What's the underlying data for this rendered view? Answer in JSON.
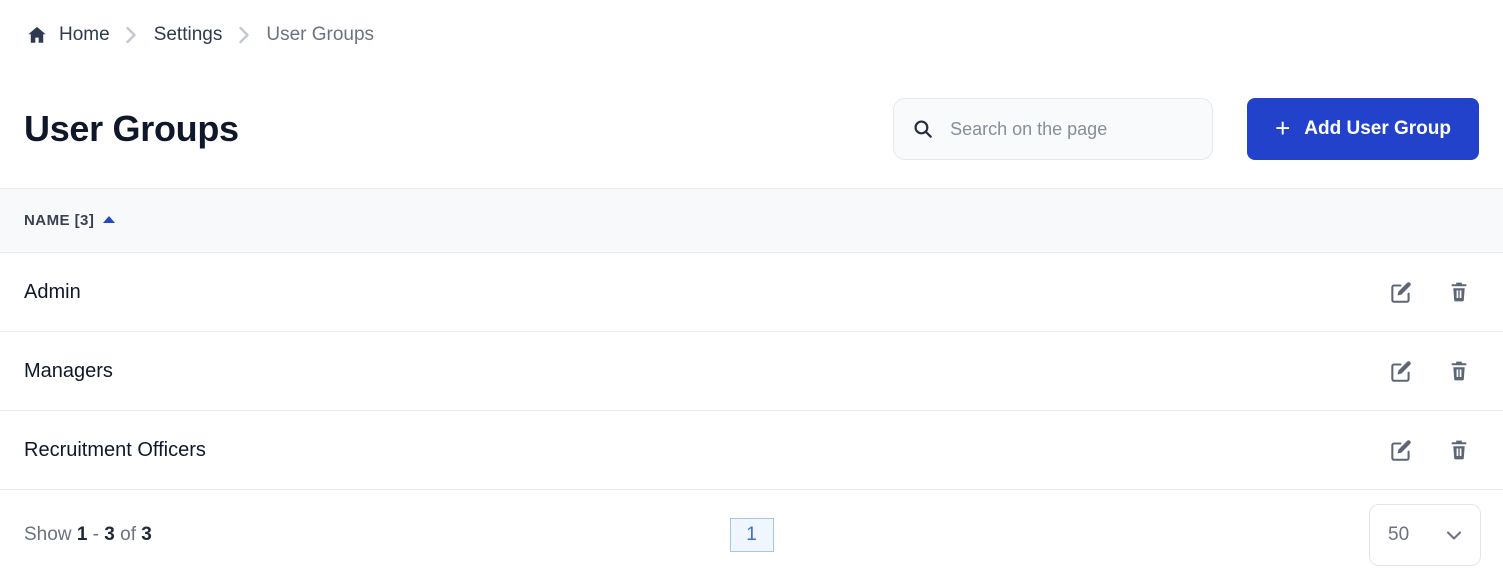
{
  "breadcrumb": {
    "home_icon": "home-icon",
    "items": [
      {
        "label": "Home",
        "current": false
      },
      {
        "label": "Settings",
        "current": false
      },
      {
        "label": "User Groups",
        "current": true
      }
    ],
    "separator": "chevron-right-icon"
  },
  "header": {
    "title": "User Groups",
    "search": {
      "placeholder": "Search on the page",
      "value": "",
      "icon": "search-icon"
    },
    "add_button": {
      "label": "Add User Group",
      "plus": "+",
      "icon": "plus-icon",
      "color": "#2342cc"
    }
  },
  "table": {
    "columns": [
      {
        "label": "NAME [3]",
        "sort": "asc",
        "sort_icon": "sort-ascending-icon",
        "sort_color": "#1e49c7"
      }
    ],
    "rows": [
      {
        "name": "Admin",
        "edit_icon": "edit-icon",
        "delete_icon": "trash-icon"
      },
      {
        "name": "Managers",
        "edit_icon": "edit-icon",
        "delete_icon": "trash-icon"
      },
      {
        "name": "Recruitment Officers",
        "edit_icon": "edit-icon",
        "delete_icon": "trash-icon"
      }
    ]
  },
  "footer": {
    "show_label": "Show",
    "range_from": "1",
    "range_dash": "-",
    "range_to": "3",
    "of_label": "of",
    "total": "3",
    "pages": [
      {
        "label": "1",
        "active": true
      }
    ],
    "page_size": {
      "selected": "50",
      "icon": "chevron-down-icon"
    }
  }
}
